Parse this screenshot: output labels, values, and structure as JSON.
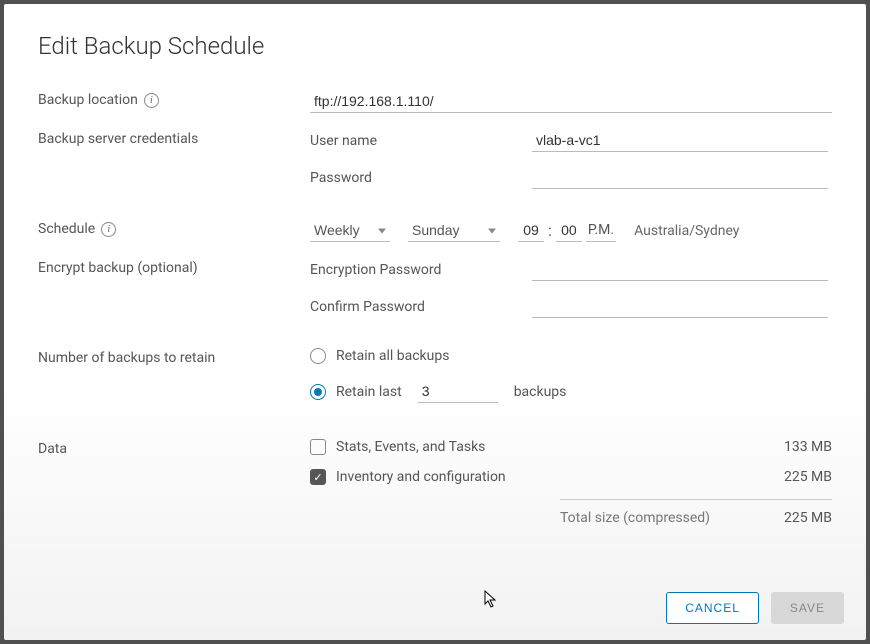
{
  "title": "Edit Backup Schedule",
  "labels": {
    "backup_location": "Backup location",
    "credentials": "Backup server credentials",
    "username": "User name",
    "password": "Password",
    "schedule": "Schedule",
    "encrypt": "Encrypt backup (optional)",
    "enc_password": "Encryption Password",
    "enc_confirm": "Confirm Password",
    "retain": "Number of backups to retain",
    "retain_all": "Retain all backups",
    "retain_last": "Retain last",
    "backups_suffix": "backups",
    "data": "Data",
    "total": "Total size (compressed)"
  },
  "values": {
    "location": "ftp://192.168.1.110/",
    "username": "vlab-a-vc1",
    "password": "",
    "frequency": "Weekly",
    "day": "Sunday",
    "hour": "09",
    "minute": "00",
    "ampm": "P.M.",
    "timezone": "Australia/Sydney",
    "enc_password": "",
    "enc_confirm": "",
    "retain_mode": "last",
    "retain_count": "3"
  },
  "data_items": [
    {
      "label": "Stats, Events, and Tasks",
      "size": "133 MB",
      "checked": false
    },
    {
      "label": "Inventory and configuration",
      "size": "225 MB",
      "checked": true
    }
  ],
  "total_size": "225 MB",
  "buttons": {
    "cancel": "CANCEL",
    "save": "SAVE"
  }
}
